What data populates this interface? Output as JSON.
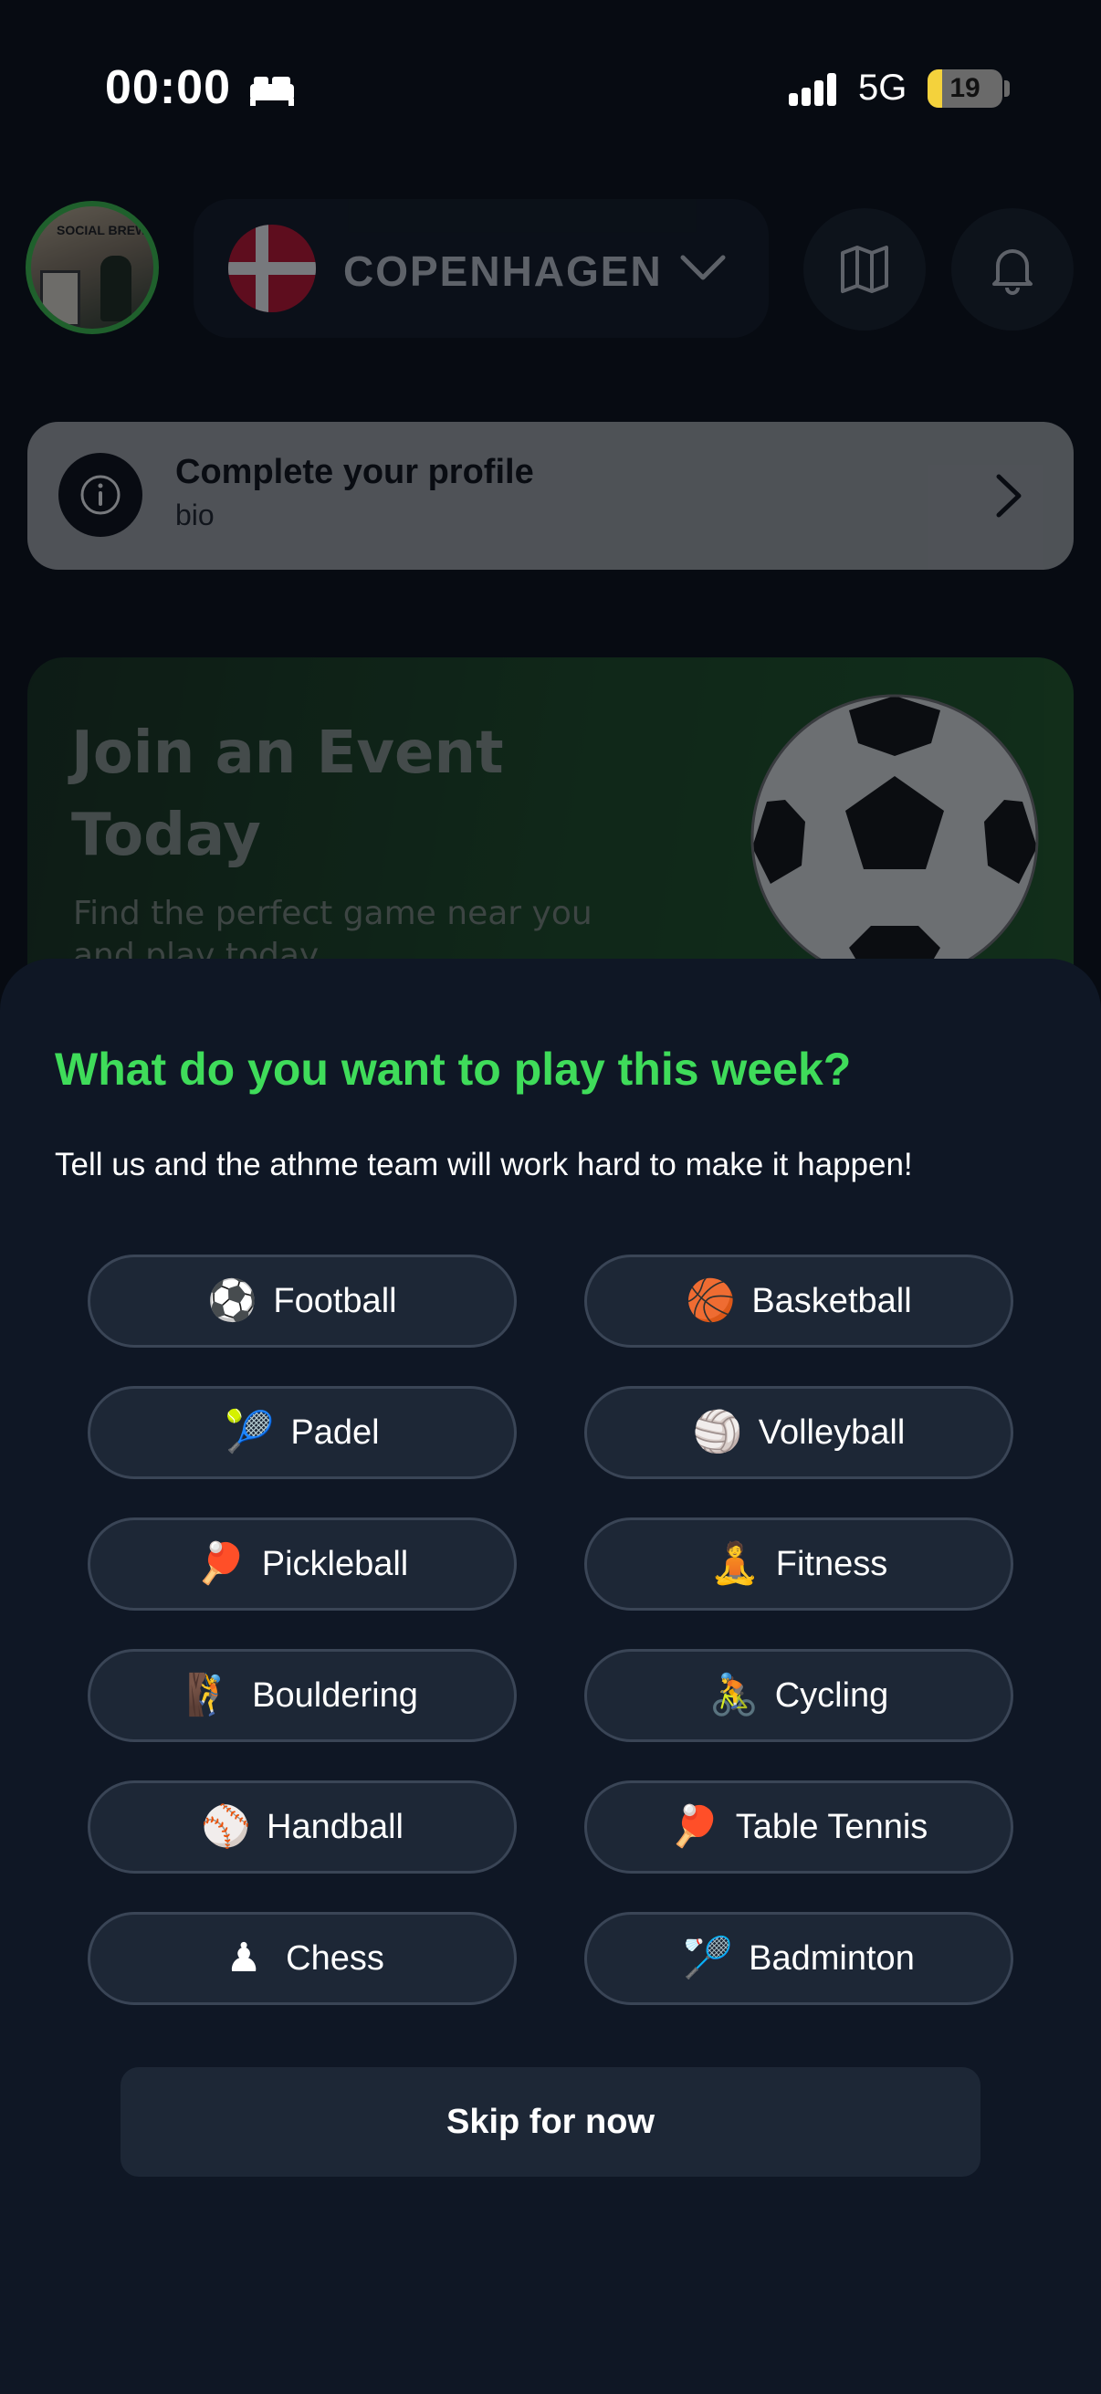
{
  "status_bar": {
    "time": "00:00",
    "network": "5G",
    "battery": "19",
    "battery_level_percent": 19,
    "icons": [
      "bed-icon",
      "signal-icon"
    ]
  },
  "header": {
    "city": "COPENHAGEN",
    "avatar_sign": "SOCIAL BREW",
    "icons": [
      "denmark-flag-icon",
      "chevron-down-icon",
      "map-icon",
      "bell-icon"
    ]
  },
  "profile_prompt": {
    "title": "Complete your profile",
    "subtitle": "bio",
    "icons": [
      "info-icon",
      "chevron-right-icon"
    ]
  },
  "event_banner": {
    "title": "Join an Event Today",
    "subtitle": "Find the perfect game near you and play today",
    "icon": "soccer-ball-icon"
  },
  "sheet": {
    "title": "What do you want to play this week?",
    "subtitle": "Tell us and the athme team will work hard to make it happen!",
    "sports": [
      {
        "label": "Football",
        "emoji": "⚽",
        "icon": "football-icon"
      },
      {
        "label": "Basketball",
        "emoji": "🏀",
        "icon": "basketball-icon"
      },
      {
        "label": "Padel",
        "emoji": "🎾",
        "icon": "padel-racket-icon"
      },
      {
        "label": "Volleyball",
        "emoji": "🏐",
        "icon": "volleyball-icon"
      },
      {
        "label": "Pickleball",
        "emoji": "🏓",
        "icon": "pickleball-icon"
      },
      {
        "label": "Fitness",
        "emoji": "🧘",
        "icon": "fitness-icon"
      },
      {
        "label": "Bouldering",
        "emoji": "🧗",
        "icon": "bouldering-icon"
      },
      {
        "label": "Cycling",
        "emoji": "🚴",
        "icon": "cycling-icon"
      },
      {
        "label": "Handball",
        "emoji": "⚾",
        "icon": "handball-icon"
      },
      {
        "label": "Table Tennis",
        "emoji": "🏓",
        "icon": "table-tennis-icon"
      },
      {
        "label": "Chess",
        "emoji": "♟",
        "icon": "chess-icon"
      },
      {
        "label": "Badminton",
        "emoji": "🏸",
        "icon": "badminton-icon"
      }
    ],
    "skip_label": "Skip for now"
  },
  "colors": {
    "accent_green": "#3fdc5a",
    "sheet_bg": "#0f1725",
    "chip_bg": "#1d2736",
    "chip_border": "#3a4556",
    "battery_yellow": "#f4d23c"
  }
}
